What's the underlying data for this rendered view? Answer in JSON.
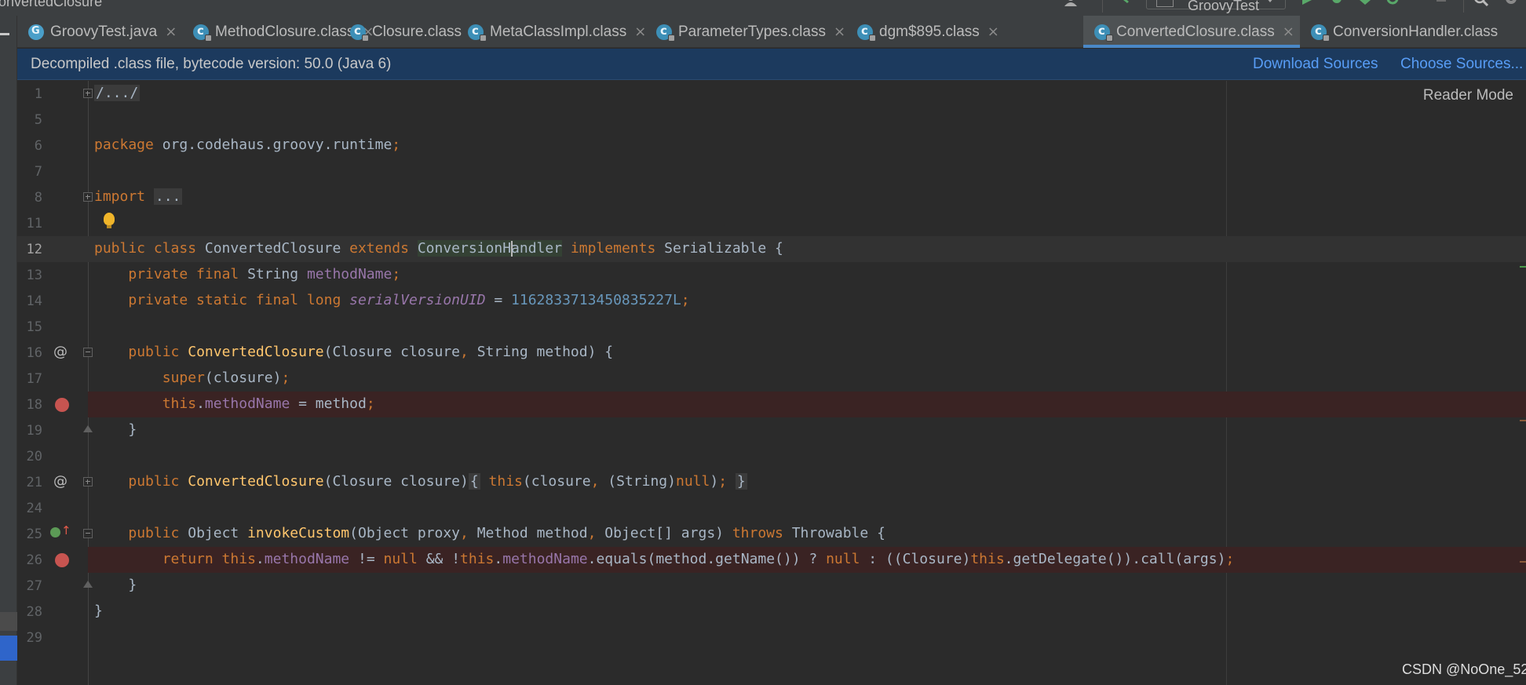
{
  "window": {
    "title": "onvertedClosure"
  },
  "toolbar": {
    "run_config": "GroovyTest"
  },
  "tabs": [
    {
      "label": "GroovyTest.java",
      "icon": "groovy-class-icon",
      "active": false
    },
    {
      "label": "MethodClosure.class",
      "icon": "class-file-icon",
      "active": false
    },
    {
      "label": "Closure.class",
      "icon": "class-file-icon",
      "active": false
    },
    {
      "label": "MetaClassImpl.class",
      "icon": "class-file-icon",
      "active": false
    },
    {
      "label": "ParameterTypes.class",
      "icon": "class-file-icon",
      "active": false
    },
    {
      "label": "dgm$895.class",
      "icon": "class-file-icon",
      "active": false
    },
    {
      "label": "ConvertedClosure.class",
      "icon": "class-file-icon",
      "active": true
    },
    {
      "label": "ConversionHandler.class",
      "icon": "class-file-icon",
      "active": false
    }
  ],
  "banner": {
    "message": "Decompiled .class file, bytecode version: 50.0 (Java 6)",
    "download_sources": "Download Sources",
    "choose_sources": "Choose Sources..."
  },
  "editor": {
    "reader_mode": "Reader Mode",
    "caret_line": 12,
    "breakpoint_lines": [
      18,
      26
    ],
    "lines": [
      {
        "num": "1",
        "text": "/.../"
      },
      {
        "num": "5",
        "text": ""
      },
      {
        "num": "6",
        "text": "package org.codehaus.groovy.runtime;"
      },
      {
        "num": "7",
        "text": ""
      },
      {
        "num": "8",
        "text": "import ..."
      },
      {
        "num": "11",
        "text": ""
      },
      {
        "num": "12",
        "text": "public class ConvertedClosure extends ConversionHandler implements Serializable {"
      },
      {
        "num": "13",
        "text": "    private final String methodName;"
      },
      {
        "num": "14",
        "text": "    private static final long serialVersionUID = 1162833713450835227L;"
      },
      {
        "num": "15",
        "text": ""
      },
      {
        "num": "16",
        "text": "    public ConvertedClosure(Closure closure, String method) {"
      },
      {
        "num": "17",
        "text": "        super(closure);"
      },
      {
        "num": "18",
        "text": "        this.methodName = method;"
      },
      {
        "num": "19",
        "text": "    }"
      },
      {
        "num": "20",
        "text": ""
      },
      {
        "num": "21",
        "text": "    public ConvertedClosure(Closure closure) { this(closure, (String)null); }"
      },
      {
        "num": "24",
        "text": ""
      },
      {
        "num": "25",
        "text": "    public Object invokeCustom(Object proxy, Method method, Object[] args) throws Throwable {"
      },
      {
        "num": "26",
        "text": "        return this.methodName != null && !this.methodName.equals(method.getName()) ? null : ((Closure)this.getDelegate()).call(args);"
      },
      {
        "num": "27",
        "text": "    }"
      },
      {
        "num": "28",
        "text": "}"
      },
      {
        "num": "29",
        "text": ""
      }
    ]
  },
  "watermark": "CSDN @NoOne_52",
  "colors": {
    "keyword": "#cc7832",
    "field": "#9876aa",
    "number": "#6897bb",
    "method_decl": "#ffc66d",
    "breakpoint": "#c75450",
    "banner_bg": "#1c3a5e",
    "link": "#589df6"
  }
}
